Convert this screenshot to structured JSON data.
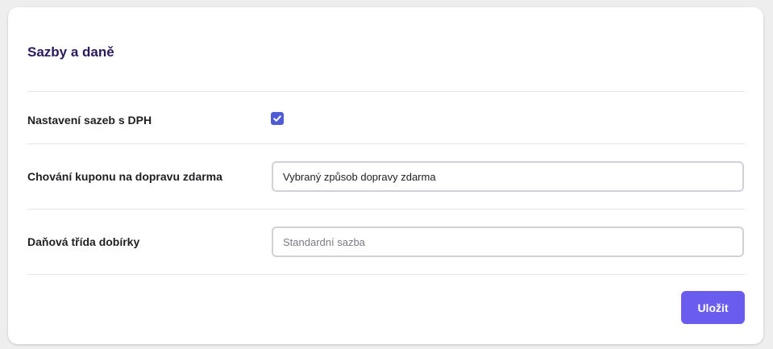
{
  "section": {
    "title": "Sazby a daně"
  },
  "rows": {
    "vat_rates": {
      "label": "Nastavení sazeb s DPH",
      "checked": true
    },
    "free_shipping_coupon": {
      "label": "Chování kuponu na dopravu zdarma",
      "value": "Vybraný způsob dopravy zdarma"
    },
    "cod_tax_class": {
      "label": "Daňová třída dobírky",
      "placeholder": "Standardní sazba"
    }
  },
  "actions": {
    "save_label": "Uložit"
  },
  "colors": {
    "accent": "#6b5cf0",
    "checkbox": "#4f5bd5",
    "title": "#2b1a5c"
  },
  "icons": {
    "checkbox": "check-icon"
  }
}
